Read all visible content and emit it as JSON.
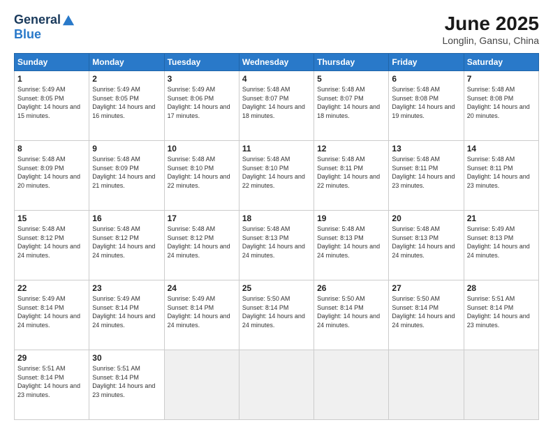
{
  "header": {
    "logo_general": "General",
    "logo_blue": "Blue",
    "month_title": "June 2025",
    "location": "Longlin, Gansu, China"
  },
  "weekdays": [
    "Sunday",
    "Monday",
    "Tuesday",
    "Wednesday",
    "Thursday",
    "Friday",
    "Saturday"
  ],
  "weeks": [
    [
      {
        "day": "1",
        "info": "Sunrise: 5:49 AM\nSunset: 8:05 PM\nDaylight: 14 hours and 15 minutes."
      },
      {
        "day": "2",
        "info": "Sunrise: 5:49 AM\nSunset: 8:05 PM\nDaylight: 14 hours and 16 minutes."
      },
      {
        "day": "3",
        "info": "Sunrise: 5:49 AM\nSunset: 8:06 PM\nDaylight: 14 hours and 17 minutes."
      },
      {
        "day": "4",
        "info": "Sunrise: 5:48 AM\nSunset: 8:07 PM\nDaylight: 14 hours and 18 minutes."
      },
      {
        "day": "5",
        "info": "Sunrise: 5:48 AM\nSunset: 8:07 PM\nDaylight: 14 hours and 18 minutes."
      },
      {
        "day": "6",
        "info": "Sunrise: 5:48 AM\nSunset: 8:08 PM\nDaylight: 14 hours and 19 minutes."
      },
      {
        "day": "7",
        "info": "Sunrise: 5:48 AM\nSunset: 8:08 PM\nDaylight: 14 hours and 20 minutes."
      }
    ],
    [
      {
        "day": "8",
        "info": "Sunrise: 5:48 AM\nSunset: 8:09 PM\nDaylight: 14 hours and 20 minutes."
      },
      {
        "day": "9",
        "info": "Sunrise: 5:48 AM\nSunset: 8:09 PM\nDaylight: 14 hours and 21 minutes."
      },
      {
        "day": "10",
        "info": "Sunrise: 5:48 AM\nSunset: 8:10 PM\nDaylight: 14 hours and 22 minutes."
      },
      {
        "day": "11",
        "info": "Sunrise: 5:48 AM\nSunset: 8:10 PM\nDaylight: 14 hours and 22 minutes."
      },
      {
        "day": "12",
        "info": "Sunrise: 5:48 AM\nSunset: 8:11 PM\nDaylight: 14 hours and 22 minutes."
      },
      {
        "day": "13",
        "info": "Sunrise: 5:48 AM\nSunset: 8:11 PM\nDaylight: 14 hours and 23 minutes."
      },
      {
        "day": "14",
        "info": "Sunrise: 5:48 AM\nSunset: 8:11 PM\nDaylight: 14 hours and 23 minutes."
      }
    ],
    [
      {
        "day": "15",
        "info": "Sunrise: 5:48 AM\nSunset: 8:12 PM\nDaylight: 14 hours and 24 minutes."
      },
      {
        "day": "16",
        "info": "Sunrise: 5:48 AM\nSunset: 8:12 PM\nDaylight: 14 hours and 24 minutes."
      },
      {
        "day": "17",
        "info": "Sunrise: 5:48 AM\nSunset: 8:12 PM\nDaylight: 14 hours and 24 minutes."
      },
      {
        "day": "18",
        "info": "Sunrise: 5:48 AM\nSunset: 8:13 PM\nDaylight: 14 hours and 24 minutes."
      },
      {
        "day": "19",
        "info": "Sunrise: 5:48 AM\nSunset: 8:13 PM\nDaylight: 14 hours and 24 minutes."
      },
      {
        "day": "20",
        "info": "Sunrise: 5:48 AM\nSunset: 8:13 PM\nDaylight: 14 hours and 24 minutes."
      },
      {
        "day": "21",
        "info": "Sunrise: 5:49 AM\nSunset: 8:13 PM\nDaylight: 14 hours and 24 minutes."
      }
    ],
    [
      {
        "day": "22",
        "info": "Sunrise: 5:49 AM\nSunset: 8:14 PM\nDaylight: 14 hours and 24 minutes."
      },
      {
        "day": "23",
        "info": "Sunrise: 5:49 AM\nSunset: 8:14 PM\nDaylight: 14 hours and 24 minutes."
      },
      {
        "day": "24",
        "info": "Sunrise: 5:49 AM\nSunset: 8:14 PM\nDaylight: 14 hours and 24 minutes."
      },
      {
        "day": "25",
        "info": "Sunrise: 5:50 AM\nSunset: 8:14 PM\nDaylight: 14 hours and 24 minutes."
      },
      {
        "day": "26",
        "info": "Sunrise: 5:50 AM\nSunset: 8:14 PM\nDaylight: 14 hours and 24 minutes."
      },
      {
        "day": "27",
        "info": "Sunrise: 5:50 AM\nSunset: 8:14 PM\nDaylight: 14 hours and 24 minutes."
      },
      {
        "day": "28",
        "info": "Sunrise: 5:51 AM\nSunset: 8:14 PM\nDaylight: 14 hours and 23 minutes."
      }
    ],
    [
      {
        "day": "29",
        "info": "Sunrise: 5:51 AM\nSunset: 8:14 PM\nDaylight: 14 hours and 23 minutes."
      },
      {
        "day": "30",
        "info": "Sunrise: 5:51 AM\nSunset: 8:14 PM\nDaylight: 14 hours and 23 minutes."
      },
      {
        "day": "",
        "info": ""
      },
      {
        "day": "",
        "info": ""
      },
      {
        "day": "",
        "info": ""
      },
      {
        "day": "",
        "info": ""
      },
      {
        "day": "",
        "info": ""
      }
    ]
  ]
}
